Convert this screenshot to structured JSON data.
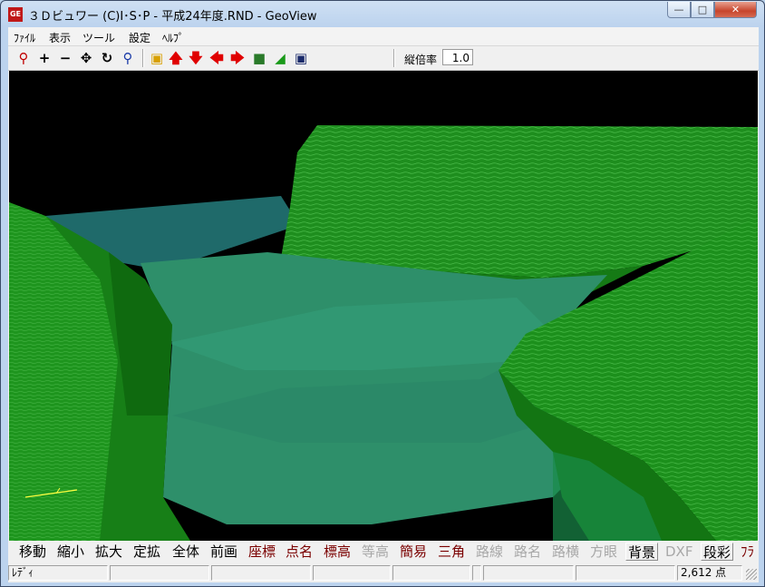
{
  "window": {
    "title": "３Ｄビュワー (C)I･S･P - 平成24年度.RND - GeoView",
    "icon": "geoview-app-icon"
  },
  "menubar": {
    "items": [
      "ﾌｧｲﾙ",
      "表示",
      "ツール",
      "設定",
      "ﾍﾙﾌﾟ"
    ]
  },
  "toolbar": {
    "icons": [
      "search-zoom-icon",
      "plus-icon",
      "minus-icon",
      "move-arrows-icon",
      "rotate-icon",
      "zoom-region-icon",
      "cube-icon",
      "arrow-up-icon",
      "arrow-down-icon",
      "arrow-left-icon",
      "arrow-right-icon",
      "box-view-icon",
      "axis-icon",
      "window-icon"
    ],
    "zoom_label": "縦倍率",
    "zoom_value": "1.0"
  },
  "colors": {
    "terrain_green": "#1d9a1d",
    "water": "#2d8f6f",
    "background": "#000000"
  },
  "commands": [
    {
      "label": "移動",
      "state": "normal"
    },
    {
      "label": "縮小",
      "state": "normal"
    },
    {
      "label": "拡大",
      "state": "normal"
    },
    {
      "label": "定拡",
      "state": "normal"
    },
    {
      "label": "全体",
      "state": "normal"
    },
    {
      "label": "前画",
      "state": "normal"
    },
    {
      "label": "座標",
      "state": "active"
    },
    {
      "label": "点名",
      "state": "active"
    },
    {
      "label": "標高",
      "state": "active"
    },
    {
      "label": "等高",
      "state": "disabled"
    },
    {
      "label": "簡易",
      "state": "active"
    },
    {
      "label": "三角",
      "state": "active"
    },
    {
      "label": "路線",
      "state": "disabled"
    },
    {
      "label": "路名",
      "state": "disabled"
    },
    {
      "label": "路横",
      "state": "disabled"
    },
    {
      "label": "方眼",
      "state": "disabled"
    },
    {
      "label": "背景",
      "state": "toggle"
    },
    {
      "label": "DXF",
      "state": "disabled"
    },
    {
      "label": "段彩",
      "state": "toggle"
    },
    {
      "label": "ﾌﾗ",
      "state": "active"
    }
  ],
  "status": {
    "ready": "ﾚﾃﾞｨ",
    "point_count": "2,612 点"
  }
}
